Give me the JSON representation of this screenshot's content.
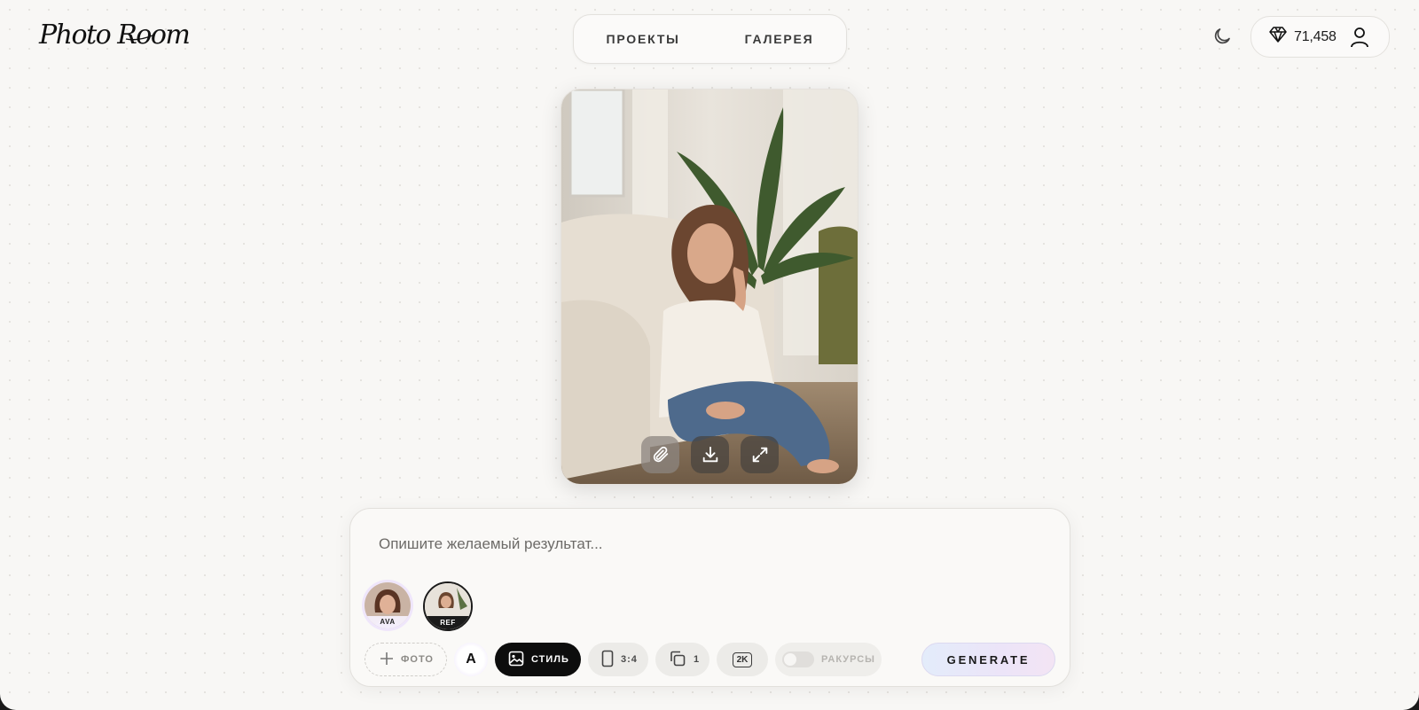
{
  "brand": {
    "logo_text": "Photo Room"
  },
  "nav": {
    "items": [
      {
        "label": "ПРОЕКТЫ"
      },
      {
        "label": "ГАЛЕРЕЯ"
      }
    ]
  },
  "header": {
    "credits": "71,458",
    "theme_icon": "moon-icon",
    "credits_icon": "diamond-icon",
    "user_icon": "user-icon"
  },
  "card": {
    "actions": [
      {
        "icon": "paperclip-icon"
      },
      {
        "icon": "download-icon"
      },
      {
        "icon": "expand-icon"
      }
    ]
  },
  "composer": {
    "placeholder": "Опишите желаемый результат...",
    "thumbnails": [
      {
        "label": "AVA"
      },
      {
        "label": "REF"
      }
    ],
    "toolbar": {
      "photo_label": "ФОТО",
      "font_label": "A",
      "style_label": "СТИЛЬ",
      "ratio": "3:4",
      "count": "1",
      "resolution": "2K",
      "angles_label": "РАКУРСЫ",
      "angles_enabled": false,
      "generate_label": "GENERATE"
    }
  },
  "colors": {
    "background": "#f8f7f5",
    "accent_dark": "#0d0d0d",
    "generate_gradient_start": "#e3ecfa",
    "generate_gradient_end": "#f3e4f4"
  }
}
